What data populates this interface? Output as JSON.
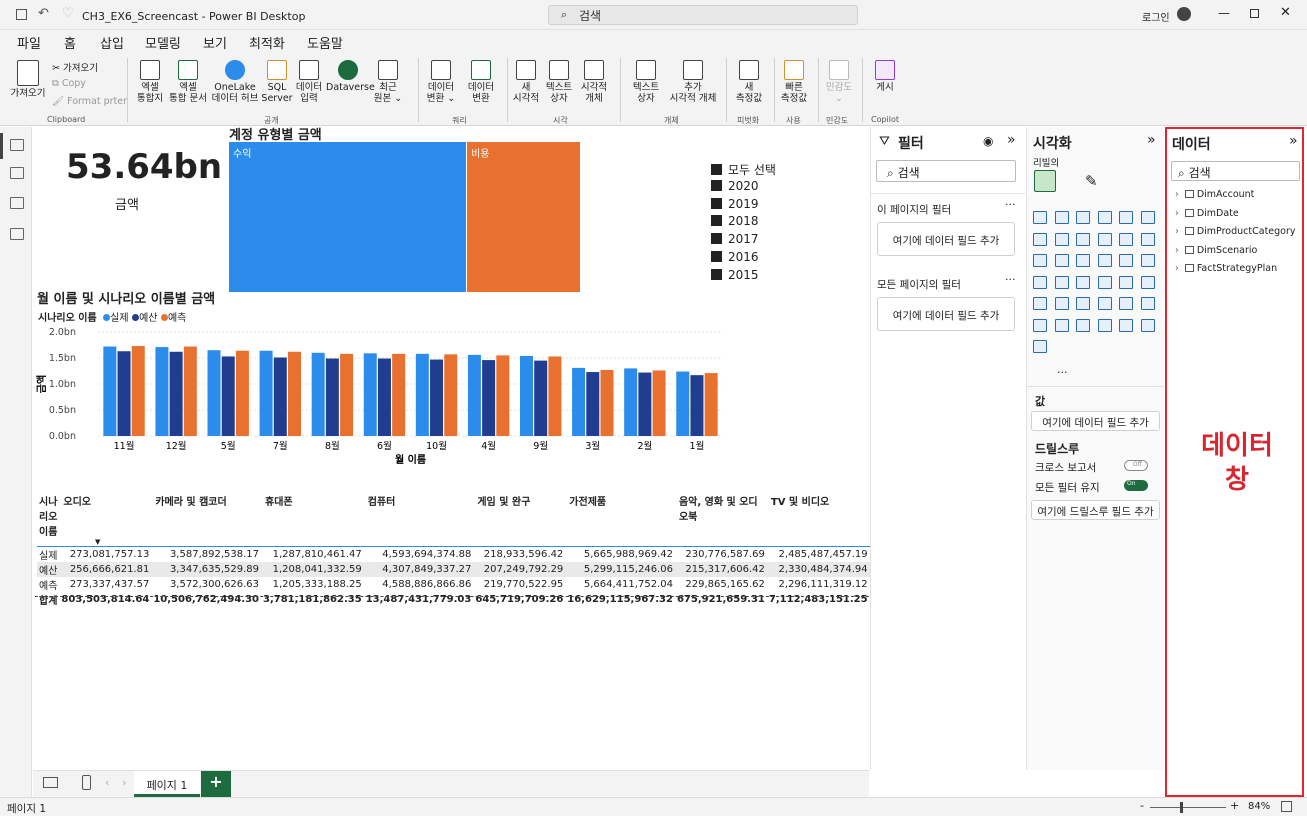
{
  "window": {
    "title": "CH3_EX6_Screencast - Power BI Desktop",
    "search": "검색",
    "signin": "로그인"
  },
  "menu": [
    "파일",
    "홈",
    "삽입",
    "모델링",
    "보기",
    "최적화",
    "도움말"
  ],
  "ribbon": {
    "clipboard": {
      "paste": "가져오기",
      "cut": "가져오기",
      "copy": "Copy",
      "format": "Format prter",
      "label": "Clipboard"
    },
    "data": [
      {
        "l1": "엑셀",
        "l2": "통합지"
      },
      {
        "l1": "엑셀",
        "l2": "통합 문서"
      },
      {
        "l1": "OneLake",
        "l2": "데이터 허브"
      },
      {
        "l1": "SQL",
        "l2": "Server"
      },
      {
        "l1": "데이터",
        "l2": "입력"
      },
      {
        "l1": "Dataverse",
        "l2": ""
      },
      {
        "l1": "최근",
        "l2": "원본 ⌄"
      }
    ],
    "data_label": "공개",
    "transform": [
      {
        "l1": "데이터",
        "l2": "변환 ⌄"
      },
      {
        "l1": "데이터",
        "l2": "변환"
      }
    ],
    "transform_label": "쿼리",
    "insert": [
      {
        "l1": "새",
        "l2": "시각적"
      },
      {
        "l1": "텍스트",
        "l2": "상자"
      },
      {
        "l1": "시각적",
        "l2": "개체"
      }
    ],
    "insert_label": "시각",
    "calc": [
      {
        "l1": "텍스트",
        "l2": "상자"
      },
      {
        "l1": "추가",
        "l2": "시각적 개체"
      }
    ],
    "calc_label": "개체",
    "measure": [
      {
        "l1": "새",
        "l2": "측정값"
      }
    ],
    "measure_label": "피벗화",
    "quick": [
      {
        "l1": "빠른",
        "l2": "측정값"
      }
    ],
    "quick_label": "사용",
    "sens": [
      {
        "l1": "민감도",
        "l2": "⌄"
      }
    ],
    "sens_label": "민감도",
    "copilot": [
      {
        "l1": "게시",
        "l2": ""
      }
    ],
    "copilot_label": "Copilot"
  },
  "card": {
    "value": "53.64bn",
    "label": "금액"
  },
  "treemap": {
    "title": "계정 유형별 금액",
    "blocks": [
      {
        "label": "수익",
        "value": 0.6,
        "color": "#2b8ceb"
      },
      {
        "label": "비용",
        "value": 0.4,
        "color": "#e8712f"
      }
    ]
  },
  "slicer": {
    "items": [
      "모두 선택",
      "2020",
      "2019",
      "2018",
      "2017",
      "2016",
      "2015"
    ]
  },
  "chart_data": {
    "type": "bar",
    "title": "월 이름 및 시나리오 이름별 금액",
    "legend_title": "시나리오 이름",
    "xlabel": "월 이름",
    "ylabel": "금액",
    "categories": [
      "11월",
      "12월",
      "5월",
      "7월",
      "8월",
      "6월",
      "10월",
      "4월",
      "9월",
      "3월",
      "2월",
      "1월"
    ],
    "series": [
      {
        "name": "실제",
        "color": "#2b8ceb",
        "values": [
          1.72,
          1.71,
          1.65,
          1.64,
          1.6,
          1.59,
          1.58,
          1.56,
          1.54,
          1.31,
          1.3,
          1.24
        ]
      },
      {
        "name": "예산",
        "color": "#203d8f",
        "values": [
          1.63,
          1.62,
          1.53,
          1.51,
          1.49,
          1.49,
          1.47,
          1.46,
          1.45,
          1.23,
          1.22,
          1.17
        ]
      },
      {
        "name": "예측",
        "color": "#e8712f",
        "values": [
          1.73,
          1.72,
          1.64,
          1.62,
          1.58,
          1.58,
          1.57,
          1.55,
          1.53,
          1.27,
          1.26,
          1.21
        ]
      }
    ],
    "ylim": [
      0,
      2.0
    ],
    "yticks": [
      "2.0bn",
      "1.5bn",
      "1.0bn",
      "0.5bn",
      "0.0bn"
    ]
  },
  "matrix": {
    "headers": [
      "시나리오 이름",
      "오디오",
      "카메라 및 캠코더",
      "휴대폰",
      "컴퓨터",
      "게임 및 완구",
      "가전제품",
      "음악, 영화 및 오디오북",
      "TV 및 비디오"
    ],
    "rows": [
      [
        "실제",
        "273,081,757.13",
        "3,587,892,538.17",
        "1,287,810,461.47",
        "4,593,694,374.88",
        "218,933,596.42",
        "5,665,988,969.42",
        "230,776,587.69",
        "2,485,487,457.19"
      ],
      [
        "예산",
        "256,666,621.81",
        "3,347,635,529.89",
        "1,208,041,332.59",
        "4,307,849,337.27",
        "207,249,792.29",
        "5,299,115,246.06",
        "215,317,606.42",
        "2,330,484,374.94"
      ],
      [
        "예측",
        "273,337,437.57",
        "3,572,300,626.63",
        "1,205,333,188.25",
        "4,588,886,866.86",
        "219,770,522.95",
        "5,664,411,752.04",
        "229,865,165.62",
        "2,296,111,319.12"
      ]
    ],
    "total": [
      "합계",
      "803,503,814.64",
      "10,506,762,494.30",
      "3,781,181,862.35",
      "13,487,431,779.03",
      "645,719,709.26",
      "16,629,115,967.32",
      "675,921,659.31",
      "7,112,483,151.25"
    ]
  },
  "filters": {
    "title": "필터",
    "search": "검색",
    "this_page": "이 페이지의 필터",
    "all_pages": "모든 페이지의 필터",
    "add_field": "여기에 데이터 필드 추가"
  },
  "viz": {
    "title": "시각화",
    "build": "리빌의",
    "values": "값",
    "add_field": "여기에 데이터 필드 추가",
    "drill": "드릴스루",
    "cross_report": "크로스 보고서",
    "keep_filters": "모든 필터 유지",
    "add_drill": "여기에 드릴스루 필드 추가",
    "off": "Off",
    "on": "On"
  },
  "data": {
    "title": "데이터",
    "search": "검색",
    "tables": [
      "DimAccount",
      "DimDate",
      "DimProductCategory",
      "DimScenario",
      "FactStrategyPlan"
    ],
    "annotation": "데이터 창"
  },
  "pages": {
    "tab": "페이지 1",
    "add": "+"
  },
  "status": {
    "page": "페이지 1",
    "zoom": "84%"
  }
}
